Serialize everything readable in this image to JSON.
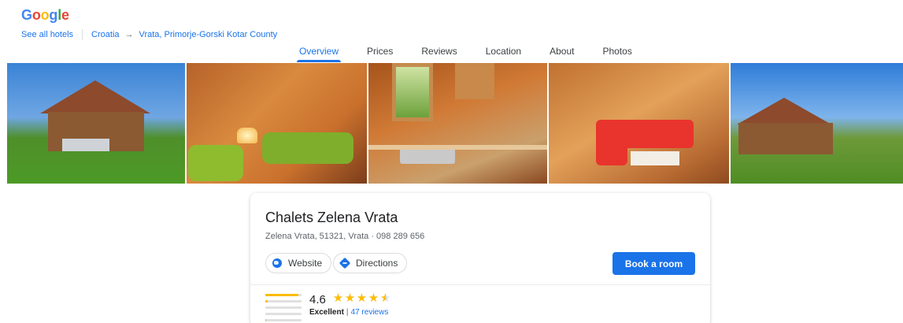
{
  "brand": {
    "logo_letters": [
      {
        "char": "G",
        "color": "#4285f4"
      },
      {
        "char": "o",
        "color": "#ea4335"
      },
      {
        "char": "o",
        "color": "#fbbc05"
      },
      {
        "char": "g",
        "color": "#4285f4"
      },
      {
        "char": "l",
        "color": "#34a853"
      },
      {
        "char": "e",
        "color": "#ea4335"
      }
    ]
  },
  "breadcrumb": {
    "see_all": "See all hotels",
    "country": "Croatia",
    "arrow": "→",
    "location": "Vrata, Primorje-Gorski Kotar County"
  },
  "tabs": [
    {
      "label": "Overview",
      "active": true
    },
    {
      "label": "Prices",
      "active": false
    },
    {
      "label": "Reviews",
      "active": false
    },
    {
      "label": "Location",
      "active": false
    },
    {
      "label": "About",
      "active": false
    },
    {
      "label": "Photos",
      "active": false
    }
  ],
  "photos": [
    {
      "name": "photo-exterior-chalet"
    },
    {
      "name": "photo-bedroom"
    },
    {
      "name": "photo-kitchen"
    },
    {
      "name": "photo-living-room"
    },
    {
      "name": "photo-exterior-garden"
    }
  ],
  "hotel": {
    "name": "Chalets Zelena Vrata",
    "address": "Zelena Vrata, 51321, Vrata · 098 289 656",
    "website_label": "Website",
    "directions_label": "Directions",
    "book_label": "Book a room"
  },
  "rating": {
    "value": "4.6",
    "stars_filled": 4.6,
    "label": "Excellent",
    "separator": "|",
    "reviews_link": "47 reviews",
    "distribution": [
      0.92,
      0.06,
      0.0,
      0.0,
      0.02
    ]
  },
  "colors": {
    "accent": "#1a73e8",
    "star": "#fbbc04"
  }
}
